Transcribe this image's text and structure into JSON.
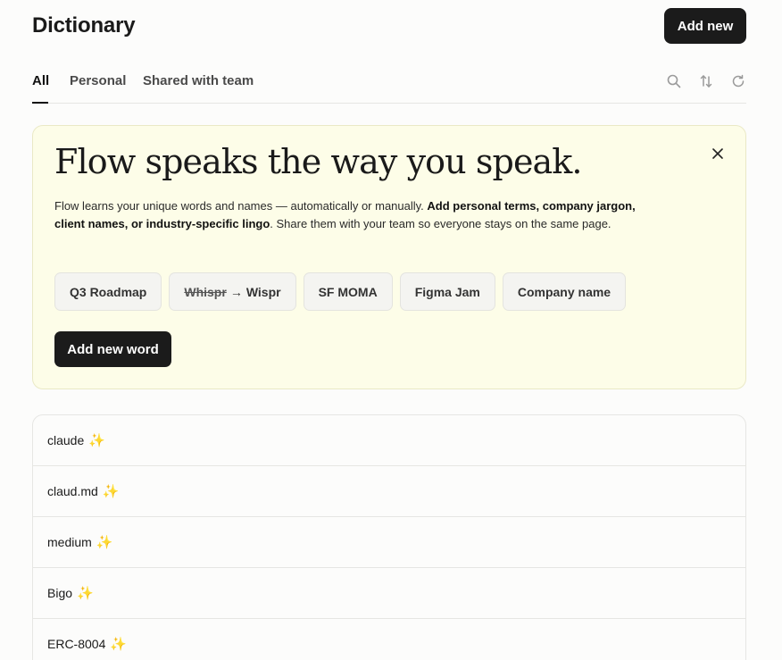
{
  "header": {
    "title": "Dictionary",
    "add_new_label": "Add new"
  },
  "tabs": [
    {
      "label": "All",
      "active": true
    },
    {
      "label": "Personal",
      "active": false
    },
    {
      "label": "Shared with team",
      "active": false
    }
  ],
  "tools": [
    "search-icon",
    "sort-icon",
    "refresh-icon"
  ],
  "promo": {
    "heading": "Flow speaks the way you speak.",
    "body_part1": "Flow learns your unique words and names — automatically or manually. ",
    "body_bold": "Add personal terms, company jargon, client names, or industry-specific lingo",
    "body_part2": ". Share them with your team so everyone stays on the same page.",
    "chips": {
      "q3": "Q3 Roadmap",
      "whispr_from": "Whispr",
      "whispr_arrow": "→",
      "whispr_to": "Wispr",
      "sfmoma": "SF MOMA",
      "figma": "Figma Jam",
      "company": "Company name"
    },
    "add_word_label": "Add new word"
  },
  "words": [
    {
      "text": "claude",
      "sparkle": "✨"
    },
    {
      "text": "claud.md",
      "sparkle": "✨"
    },
    {
      "text": "medium",
      "sparkle": "✨"
    },
    {
      "text": "Bigo",
      "sparkle": "✨"
    },
    {
      "text": "ERC-8004",
      "sparkle": "✨"
    }
  ],
  "colors": {
    "background": "#fcfcfb",
    "promo_background": "#fdfde8",
    "primary_button": "#1b1b1b",
    "sparkle": "#f0b93a"
  }
}
